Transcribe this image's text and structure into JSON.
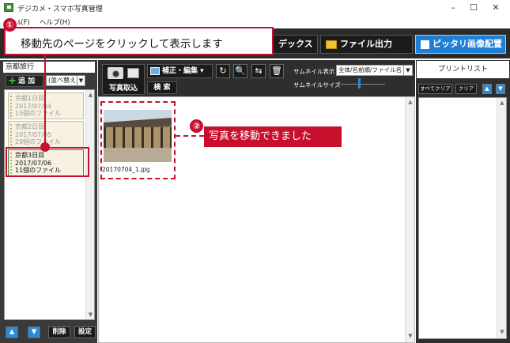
{
  "window": {
    "title": "デジカメ・スマホ写真管理",
    "minimize_glyph": "–",
    "maximize_glyph": "☐",
    "close_glyph": "✕"
  },
  "menu": {
    "items": [
      "ﾙ(F)",
      "ヘルプ(H)"
    ]
  },
  "toolbar": {
    "index_label": "デックス",
    "file_export_label": "ファイル出力",
    "fit_layout_label": "ピッタリ画像配置"
  },
  "left_panel": {
    "folder_name": "京都旅行",
    "add_label": "追 加",
    "sort_label": "(並べ替え)",
    "pages": [
      {
        "title": "京都1日目",
        "date": "2017/07/04",
        "count": "15個のファイル"
      },
      {
        "title": "京都2日目",
        "date": "2017/07/05",
        "count": "29個のファイル"
      },
      {
        "title": "京都3日目",
        "date": "2017/07/06",
        "count": "11個のファイル"
      }
    ],
    "delete_label": "削除",
    "settings_label": "設定"
  },
  "center": {
    "import_label": "写真取込",
    "edit_label": "補正・編集",
    "search_label": "検 索",
    "thumb_display_label": "サムネイル表示",
    "thumb_display_value": "全体/名前順/ファイル名",
    "thumb_size_label": "サムネイルサイズ",
    "thumb_size_level": 0.45,
    "photos": [
      {
        "filename": "20170704_1.jpg"
      }
    ]
  },
  "right_panel": {
    "title": "プリントリスト",
    "clear_all_label": "すべてクリア",
    "clear_label": "クリア"
  },
  "annotations": {
    "step1_number": "①",
    "step1_text": "移動先のページをクリックして表示します",
    "step2_number": "②",
    "step2_text": "写真を移動できました"
  },
  "colors": {
    "annotation_red": "#c8102e",
    "toolbar_dark": "#2b2b2b",
    "accent_blue": "#1e7fd6"
  }
}
